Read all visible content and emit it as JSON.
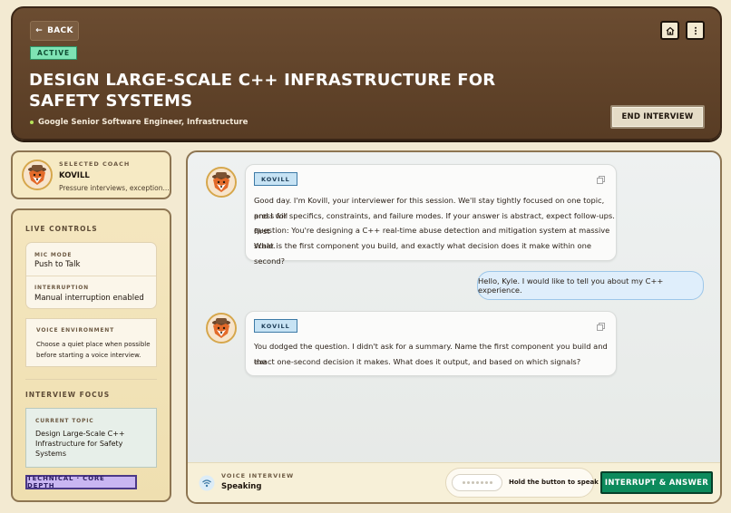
{
  "header": {
    "back_label": "BACK",
    "status_badge": "ACTIVE",
    "title": "DESIGN LARGE-SCALE C++ INFRASTRUCTURE FOR SAFETY SYSTEMS",
    "role": "Google Senior Software Engineer, Infrastructure",
    "end_label": "END INTERVIEW",
    "icons": [
      "home-icon",
      "more-vertical-icon"
    ]
  },
  "coach": {
    "label": "SELECTED COACH",
    "name": "KOVILL",
    "description": "Pressure interviews, exception..."
  },
  "controls": {
    "title": "LIVE CONTROLS",
    "mic_mode_label": "MIC MODE",
    "mic_mode_value": "Push to Talk",
    "interruption_label": "INTERRUPTION",
    "interruption_value": "Manual interruption enabled",
    "voice_env_label": "VOICE ENVIRONMENT",
    "voice_env_text": "Choose a quiet place when possible before starting a voice interview.",
    "focus_title": "INTERVIEW FOCUS",
    "topic_label": "CURRENT TOPIC",
    "topic_value": "Design Large-Scale C++ Infrastructure for Safety Systems",
    "tag": "TECHNICAL · CORE DEPTH"
  },
  "messages": [
    {
      "speaker": "KOVILL",
      "lines": [
        "Good day. I'm Kovill, your interviewer for this session. We'll stay tightly focused on one topic, and I will",
        "press for specifics, constraints, and failure modes. If your answer is abstract, expect follow-ups. First",
        "question: You're designing a C++ real-time abuse detection and mitigation system at massive scale.",
        "What is the first component you build, and exactly what decision does it make within one second?"
      ]
    },
    {
      "speaker": "user",
      "text": "Hello, Kyle. I would like to tell you about my C++ experience."
    },
    {
      "speaker": "KOVILL",
      "lines": [
        "You dodged the question. I didn't ask for a summary. Name the first component you build and the",
        "exact one-second decision it makes. What does it output, and based on which signals?"
      ]
    }
  ],
  "bottom": {
    "voice_label": "VOICE INTERVIEW",
    "voice_status": "Speaking",
    "ptt_hint": "Hold the button to speak",
    "interrupt_label": "INTERRUPT & ANSWER"
  }
}
